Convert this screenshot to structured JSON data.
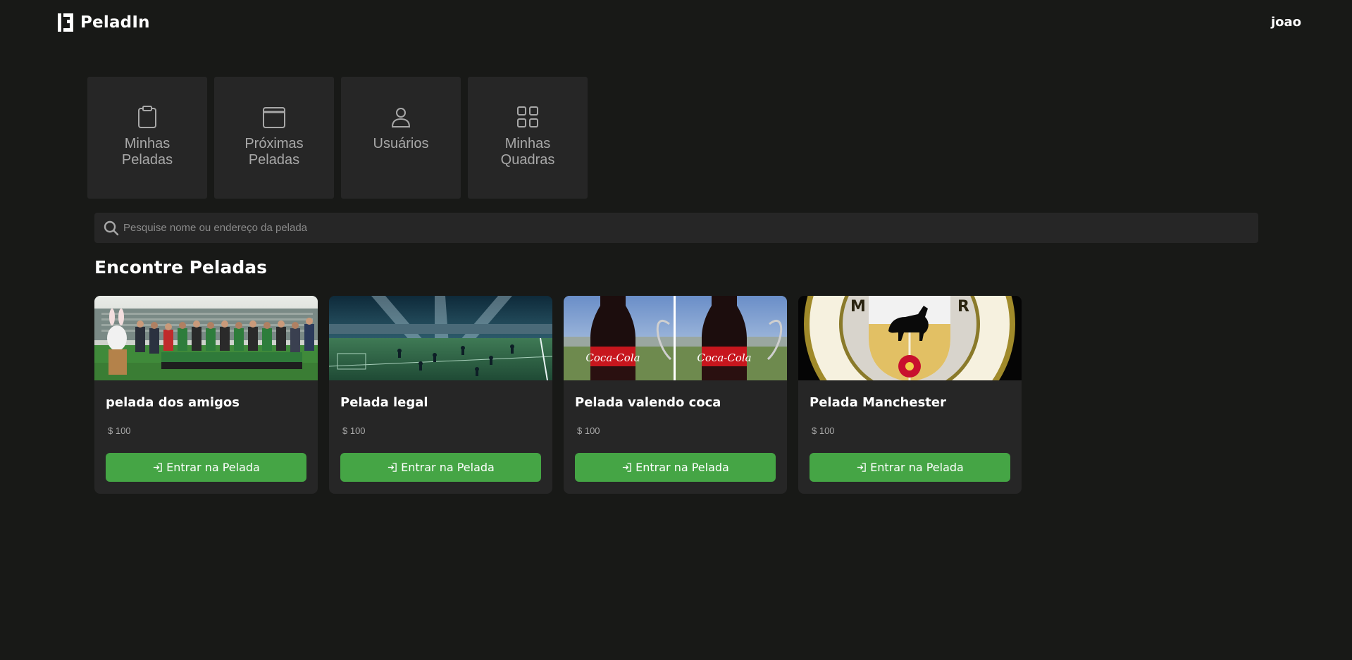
{
  "header": {
    "brand": "PeladIn",
    "user": "joao"
  },
  "tiles": [
    {
      "label": "Minhas\nPeladas",
      "icon": "clipboard-icon"
    },
    {
      "label": "Próximas\nPeladas",
      "icon": "calendar-icon"
    },
    {
      "label": "Usuários",
      "icon": "user-icon"
    },
    {
      "label": "Minhas\nQuadras",
      "icon": "grid-icon"
    }
  ],
  "search": {
    "placeholder": "Pesquise nome ou endereço da pelada",
    "value": ""
  },
  "section": {
    "title": "Encontre Peladas"
  },
  "cards": [
    {
      "title": "pelada dos amigos",
      "price": "$ 100",
      "button": "Entrar na Pelada",
      "image": "team-photo"
    },
    {
      "title": "Pelada legal",
      "price": "$ 100",
      "button": "Entrar na Pelada",
      "image": "stadium-illustration"
    },
    {
      "title": "Pelada valendo coca",
      "price": "$ 100",
      "button": "Entrar na Pelada",
      "image": "coca-cola-bottles"
    },
    {
      "title": "Pelada Manchester",
      "price": "$ 100",
      "button": "Entrar na Pelada",
      "image": "club-crest"
    }
  ],
  "colors": {
    "background": "#181917",
    "surface": "#262626",
    "accent": "#45a545",
    "muted_text": "#a8a8a8"
  }
}
